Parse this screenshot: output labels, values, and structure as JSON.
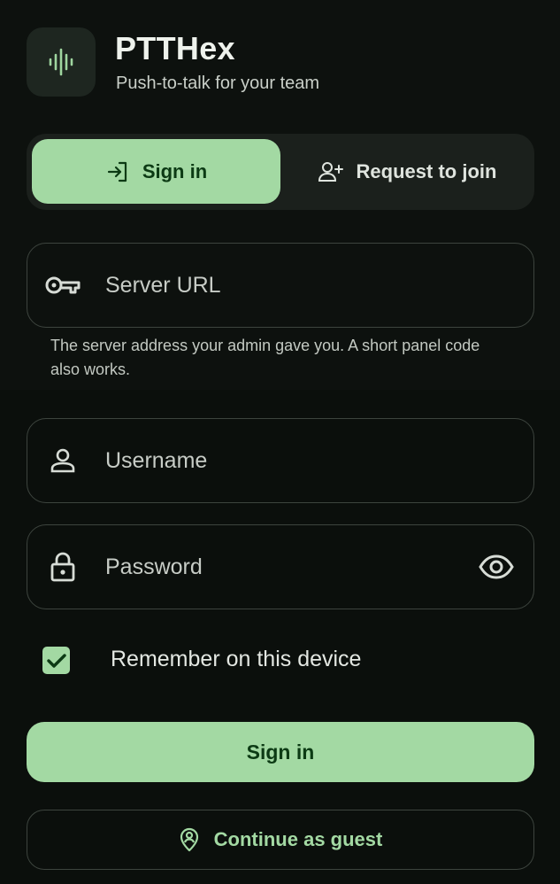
{
  "header": {
    "title": "PTTHex",
    "subtitle": "Push-to-talk for your team",
    "logo_icon": "waveform-icon"
  },
  "tabs": [
    {
      "label": "Sign in",
      "icon": "login-icon",
      "selected": true
    },
    {
      "label": "Request to join",
      "icon": "person-add-icon",
      "selected": false
    }
  ],
  "server_field": {
    "placeholder": "Server URL",
    "value": "",
    "icon": "key-icon",
    "helper": "The server address your admin gave you. A short panel code also works."
  },
  "username_field": {
    "placeholder": "Username",
    "value": "",
    "icon": "person-icon"
  },
  "password_field": {
    "placeholder": "Password",
    "value": "",
    "icon": "lock-icon",
    "toggle_icon": "eye-icon"
  },
  "remember": {
    "label": "Remember on this device",
    "checked": true
  },
  "actions": {
    "sign_in_label": "Sign in",
    "guest_label": "Continue as guest",
    "guest_icon": "location-person-icon"
  },
  "colors": {
    "background": "#0b0f0c",
    "accent": "#a3d9a3",
    "accent_text": "#0c3a14",
    "outline": "#3d443e",
    "surface": "#1b201c"
  }
}
